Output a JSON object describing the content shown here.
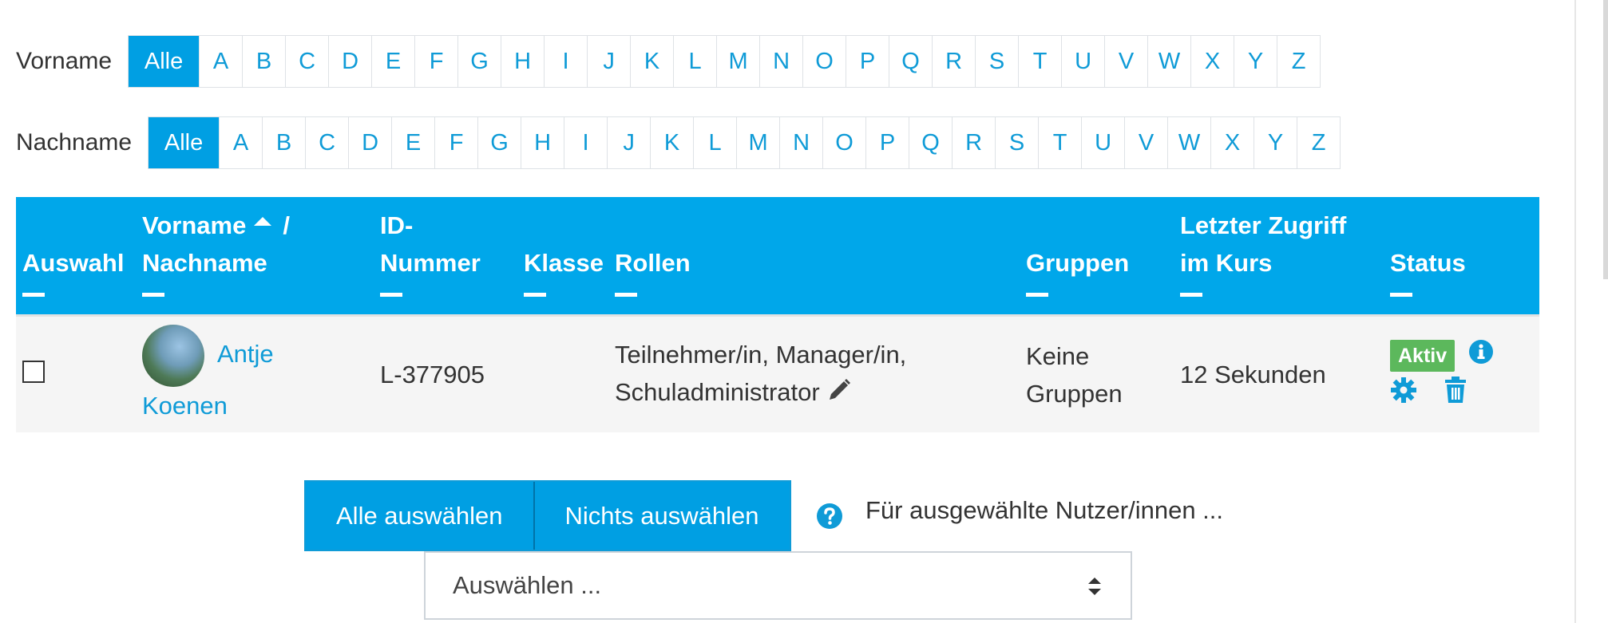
{
  "filters": {
    "first": {
      "label": "Vorname",
      "all": "Alle",
      "letters": [
        "A",
        "B",
        "C",
        "D",
        "E",
        "F",
        "G",
        "H",
        "I",
        "J",
        "K",
        "L",
        "M",
        "N",
        "O",
        "P",
        "Q",
        "R",
        "S",
        "T",
        "U",
        "V",
        "W",
        "X",
        "Y",
        "Z"
      ]
    },
    "last": {
      "label": "Nachname",
      "all": "Alle",
      "letters": [
        "A",
        "B",
        "C",
        "D",
        "E",
        "F",
        "G",
        "H",
        "I",
        "J",
        "K",
        "L",
        "M",
        "N",
        "O",
        "P",
        "Q",
        "R",
        "S",
        "T",
        "U",
        "V",
        "W",
        "X",
        "Y",
        "Z"
      ]
    }
  },
  "table": {
    "headers": {
      "select": "Auswahl",
      "firstname": "Vorname",
      "slash": "/",
      "lastname": "Nachname",
      "id_line1": "ID-",
      "id_line2": "Nummer",
      "klasse": "Klasse",
      "roles": "Rollen",
      "groups": "Gruppen",
      "access_line1": "Letzter Zugriff",
      "access_line2": "im Kurs",
      "status": "Status"
    },
    "rows": [
      {
        "first_name": "Antje",
        "last_name": "Koenen",
        "id_number": "L-377905",
        "klasse": "",
        "roles_line1": "Teilnehmer/in, Manager/in,",
        "roles_line2": "Schuladministrator",
        "groups_line1": "Keine",
        "groups_line2": "Gruppen",
        "last_access": "12 Sekunden",
        "status": "Aktiv"
      }
    ]
  },
  "actions": {
    "select_all": "Alle auswählen",
    "select_none": "Nichts auswählen",
    "bulk_label": "Für ausgewählte Nutzer/innen ...",
    "bulk_select_value": "Auswählen ..."
  },
  "colors": {
    "accent": "#00a7ea",
    "link": "#0f9bd7",
    "active_badge": "#5cb85c"
  },
  "icons": [
    "sort-up-icon",
    "pencil-icon",
    "info-icon",
    "gear-icon",
    "trash-icon",
    "help-icon",
    "select-caret-icon"
  ]
}
